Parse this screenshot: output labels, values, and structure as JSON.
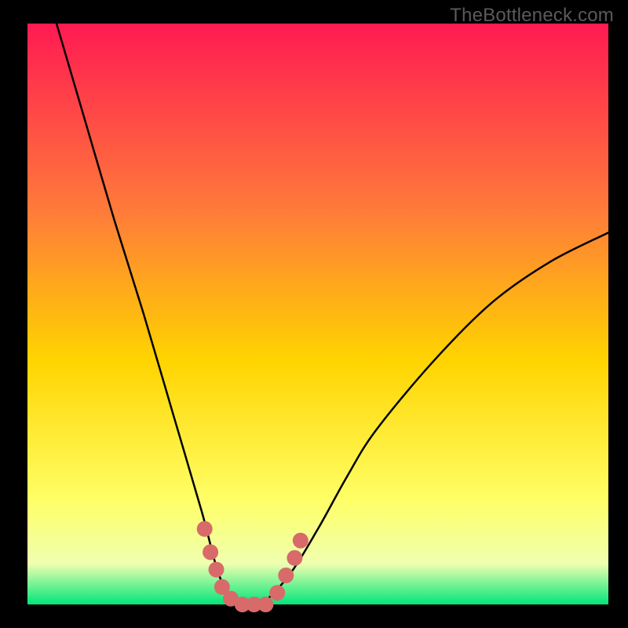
{
  "watermark": "TheBottleneck.com",
  "colors": {
    "bg_top": "#ff1a52",
    "bg_mid1": "#ff7a3a",
    "bg_mid2": "#ffd400",
    "bg_low1": "#ffff66",
    "bg_low2": "#efffb0",
    "bg_bottom": "#00e67a",
    "curve": "#000000",
    "highlight": "#d86a6a",
    "frame": "#000000"
  },
  "chart_data": {
    "type": "line",
    "title": "",
    "xlabel": "",
    "ylabel": "",
    "xlim": [
      0,
      100
    ],
    "ylim": [
      0,
      100
    ],
    "series": [
      {
        "name": "bottleneck-curve",
        "x": [
          5,
          10,
          15,
          20,
          25,
          30,
          33,
          36,
          40,
          45,
          50,
          55,
          60,
          70,
          80,
          90,
          100
        ],
        "y": [
          100,
          83,
          66,
          50,
          33,
          16,
          5,
          0,
          0,
          5,
          13,
          22,
          30,
          42,
          52,
          59,
          64
        ]
      }
    ],
    "highlights": {
      "name": "highlight-dots",
      "points": [
        {
          "x": 30.5,
          "y": 13
        },
        {
          "x": 31.5,
          "y": 9
        },
        {
          "x": 32.5,
          "y": 6
        },
        {
          "x": 33.5,
          "y": 3
        },
        {
          "x": 35,
          "y": 1
        },
        {
          "x": 37,
          "y": 0
        },
        {
          "x": 39,
          "y": 0
        },
        {
          "x": 41,
          "y": 0
        },
        {
          "x": 43,
          "y": 2
        },
        {
          "x": 44.5,
          "y": 5
        },
        {
          "x": 46,
          "y": 8
        },
        {
          "x": 47,
          "y": 11
        }
      ]
    }
  }
}
